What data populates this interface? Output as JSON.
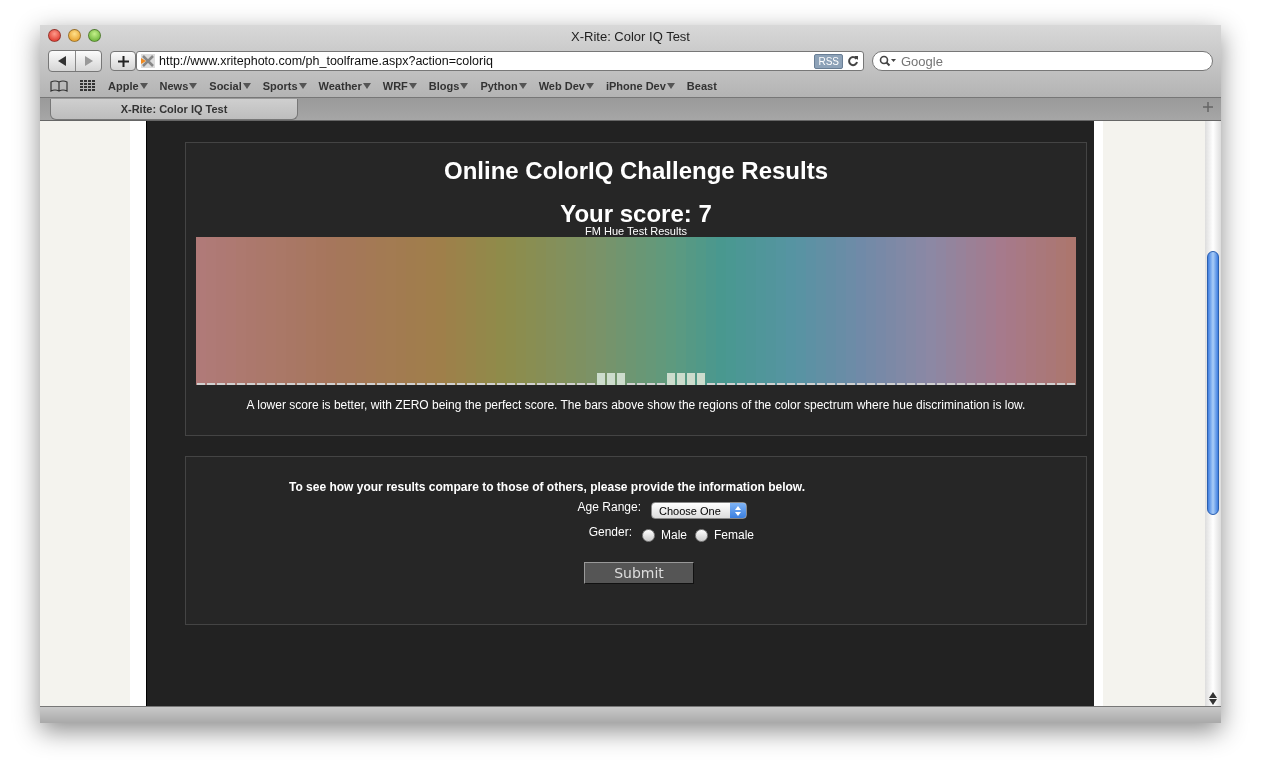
{
  "window": {
    "title": "X-Rite: Color IQ Test"
  },
  "toolbar": {
    "url": "http://www.xritephoto.com/ph_toolframe.aspx?action=coloriq",
    "rss_badge": "RSS",
    "search": {
      "placeholder": "Google"
    }
  },
  "bookmarks": [
    {
      "label": "Apple",
      "menu": true
    },
    {
      "label": "News",
      "menu": true
    },
    {
      "label": "Social",
      "menu": true
    },
    {
      "label": "Sports",
      "menu": true
    },
    {
      "label": "Weather",
      "menu": true
    },
    {
      "label": "WRF",
      "menu": true
    },
    {
      "label": "Blogs",
      "menu": true
    },
    {
      "label": "Python",
      "menu": true
    },
    {
      "label": "Web Dev",
      "menu": true
    },
    {
      "label": "iPhone Dev",
      "menu": true
    },
    {
      "label": "Beast",
      "menu": false
    }
  ],
  "tabs": [
    {
      "label": "X-Rite: Color IQ Test",
      "selected": true
    }
  ],
  "results": {
    "heading": "Online ColorIQ Challenge Results",
    "score": "Your score: 7",
    "chart_title": "FM Hue Test Results",
    "note": "A lower score is better, with ZERO being the perfect score. The bars above show the regions of the color spectrum where hue discrimination is low."
  },
  "form": {
    "intro": "To see how your results compare to those of others, please provide the information below.",
    "age_label": "Age Range:",
    "age_select": "Choose One",
    "gender_label": "Gender:",
    "gender_options": [
      {
        "label": "Male",
        "selected": false
      },
      {
        "label": "Female",
        "selected": false
      }
    ],
    "submit": "Submit"
  }
}
